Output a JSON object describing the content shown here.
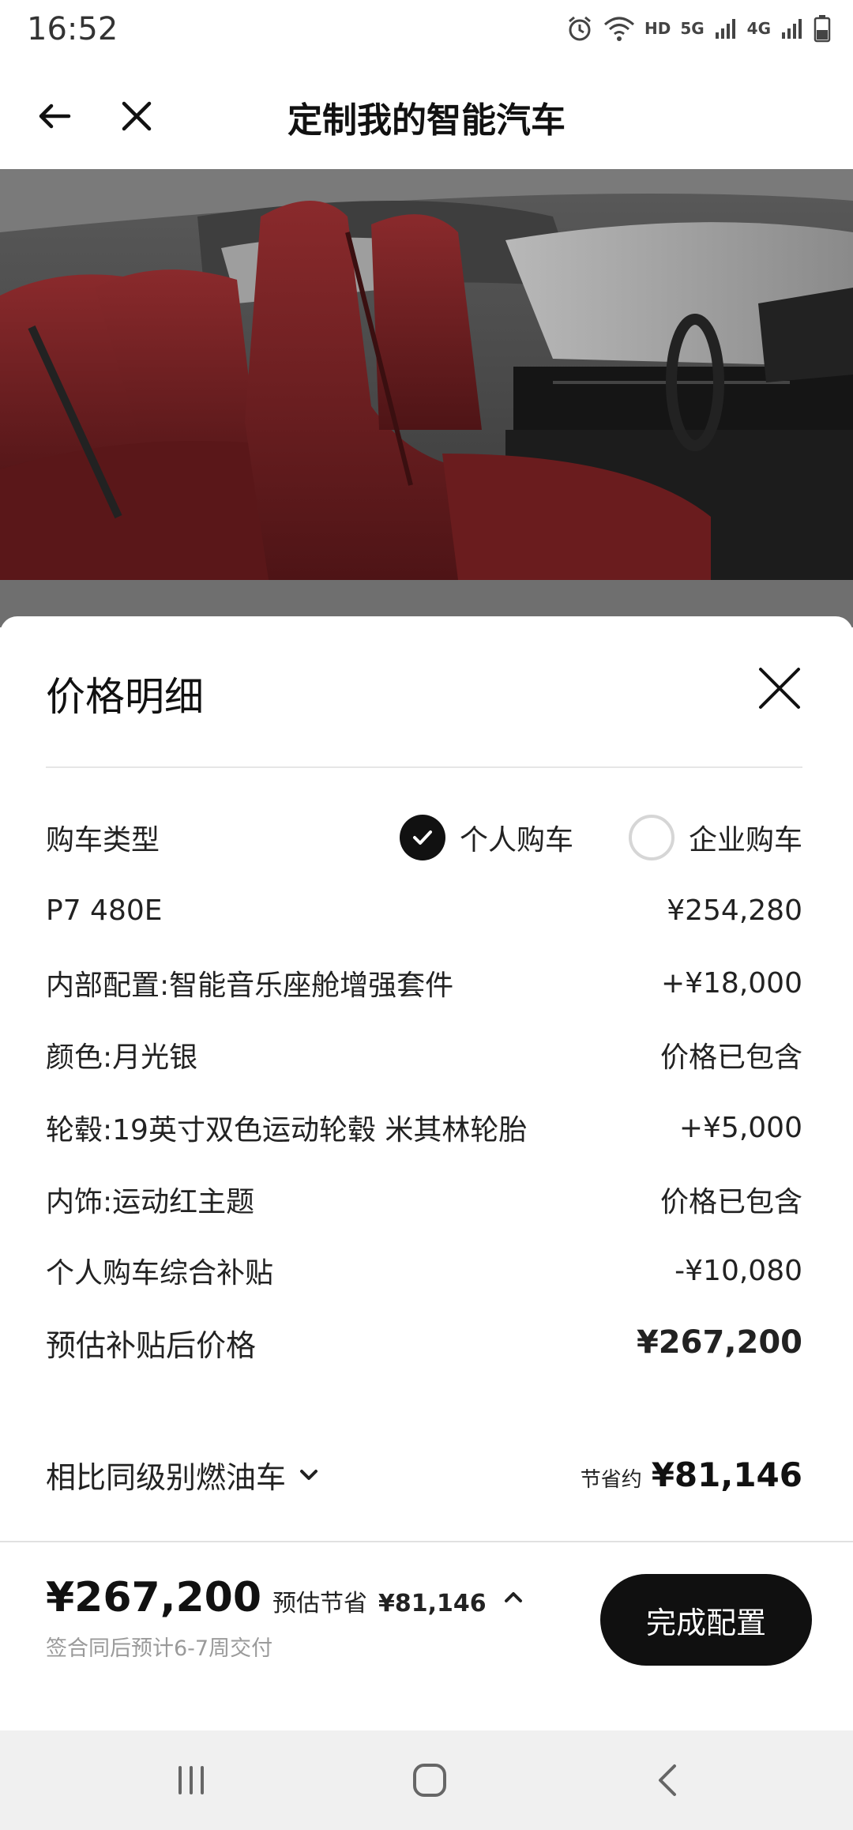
{
  "status_bar": {
    "time": "16:52",
    "hd_label": "HD",
    "net_5g": "5G",
    "net_4g": "4G",
    "icons": [
      "alarm-icon",
      "wifi-icon",
      "signal-icon",
      "battery-icon"
    ]
  },
  "header": {
    "title": "定制我的智能汽车",
    "back_icon": "arrow-left-icon",
    "close_icon": "close-icon"
  },
  "hero": {
    "description_icon": "car-interior-image"
  },
  "price_sheet": {
    "title": "价格明细",
    "close_icon": "close-icon",
    "purchase_type": {
      "label": "购车类型",
      "options": [
        {
          "label": "个人购车",
          "checked": true
        },
        {
          "label": "企业购车",
          "checked": false
        }
      ]
    },
    "rows": [
      {
        "label": "P7 480E",
        "value": "¥254,280"
      },
      {
        "label": "内部配置:智能音乐座舱增强套件",
        "value": "+¥18,000"
      },
      {
        "label": "颜色:月光银",
        "value": "价格已包含"
      },
      {
        "label": "轮毂:19英寸双色运动轮毂 米其林轮胎",
        "value": "+¥5,000"
      },
      {
        "label": "内饰:运动红主题",
        "value": "价格已包含"
      },
      {
        "label": "个人购车综合补贴",
        "value": "-¥10,080"
      },
      {
        "label": "预估补贴后价格",
        "value": "¥267,200"
      }
    ],
    "compare": {
      "label": "相比同级别燃油车",
      "saving_prefix": "节省约",
      "saving_value": "¥81,146"
    }
  },
  "footer": {
    "price": "¥267,200",
    "estimate_label": "预估节省",
    "estimate_value": "¥81,146",
    "delivery_note": "签合同后预计6-7周交付",
    "finish_button": "完成配置"
  },
  "navbar": {
    "items": [
      "recent-apps-icon",
      "home-icon",
      "back-icon"
    ]
  },
  "colors": {
    "primary_dark": "#101010",
    "seat_red": "#6e1d1f",
    "muted_text": "#9a9a9a"
  }
}
